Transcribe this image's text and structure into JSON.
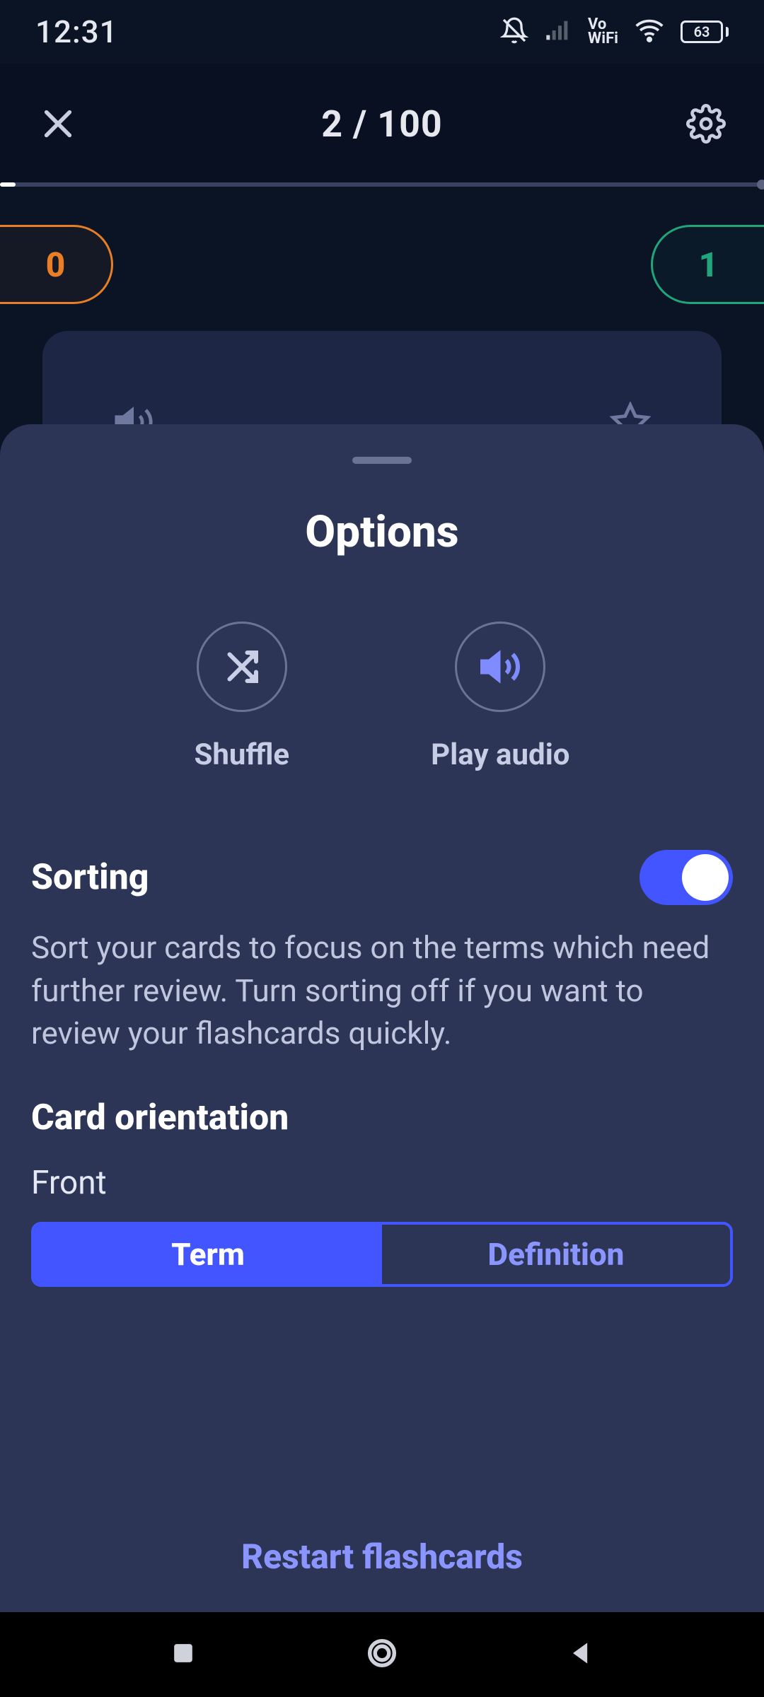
{
  "status": {
    "time": "12:31",
    "network_label": "Vo\nWiFi",
    "battery": "63"
  },
  "appbar": {
    "progress_label": "2 / 100"
  },
  "scores": {
    "left": "0",
    "right": "1"
  },
  "sheet": {
    "title": "Options",
    "options": {
      "shuffle_label": "Shuffle",
      "play_audio_label": "Play audio"
    },
    "sorting": {
      "title": "Sorting",
      "description": "Sort your cards to focus on the terms which need further review. Turn sorting off if you want to review your flashcards quickly.",
      "enabled": true
    },
    "orientation": {
      "title": "Card orientation",
      "front_label": "Front",
      "segments": {
        "term": "Term",
        "definition": "Definition"
      },
      "active": "term"
    },
    "restart_label": "Restart flashcards"
  }
}
